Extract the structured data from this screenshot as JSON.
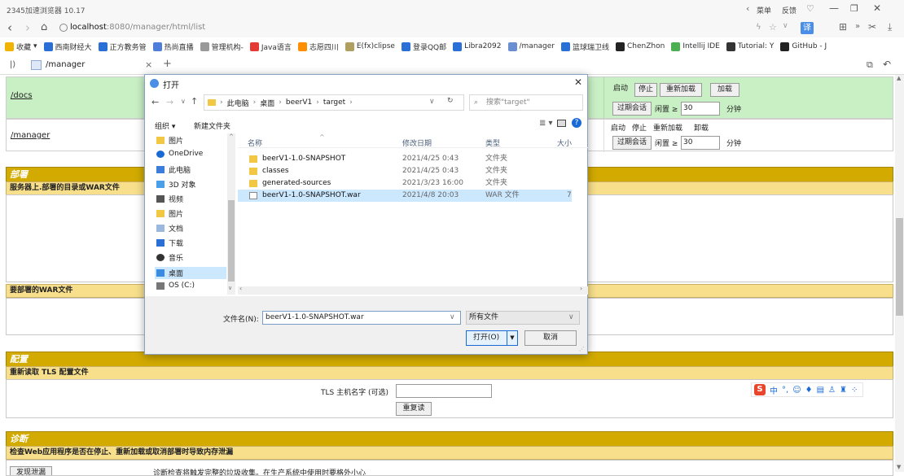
{
  "browser": {
    "app_title": "2345加速浏览器 10.17",
    "top_right": {
      "menu": "菜单",
      "feedback": "反馈"
    },
    "url_host": "localhost",
    "url_rest": ":8080/manager/html/list",
    "ext_label": "译"
  },
  "bookmarks": [
    {
      "label": "收藏",
      "color": "#f0b400"
    },
    {
      "label": "西南财经大",
      "color": "#2a6fd6"
    },
    {
      "label": "正方教务管",
      "color": "#2a6fd6"
    },
    {
      "label": "热尚直播",
      "color": "#4e7ed9"
    },
    {
      "label": "管理机构-",
      "color": "#999999"
    },
    {
      "label": "Java语言",
      "color": "#e53935"
    },
    {
      "label": "志愿四川",
      "color": "#ff8f00"
    },
    {
      "label": "E(fx)clipse",
      "color": "#b0a060"
    },
    {
      "label": "登录QQ邮",
      "color": "#2a6fd6"
    },
    {
      "label": "Libra2092",
      "color": "#2a6fd6"
    },
    {
      "label": "/manager",
      "color": "#6a8fd0"
    },
    {
      "label": "篮球瑞卫线",
      "color": "#2a6fd6"
    },
    {
      "label": "ChenZhon",
      "color": "#222222"
    },
    {
      "label": "Intellij IDE",
      "color": "#4caf50"
    },
    {
      "label": "Tutorial: Y",
      "color": "#333333"
    },
    {
      "label": "GitHub - J",
      "color": "#222222"
    }
  ],
  "tab": {
    "title": "/manager"
  },
  "manager": {
    "rows": [
      {
        "path": "/docs",
        "start": "启动",
        "stop": "停止",
        "reload": "重新加载",
        "deploy": "加载",
        "expire": "过期会话",
        "idle": "闲置 ≥",
        "idle_value": "30",
        "minutes": "分钟"
      },
      {
        "path": "/manager",
        "start": "启动",
        "stop": "停止",
        "reload": "重新加载",
        "deploy": "卸载",
        "expire": "过期会话",
        "idle": "闲置 ≥",
        "idle_value": "30",
        "minutes": "分钟"
      }
    ],
    "deploy": {
      "title": "部署",
      "server_dir": "服务器上.部署的目录或WAR文件",
      "war_upload": "要部署的WAR文件"
    },
    "config": {
      "title": "配置",
      "reload_tls": "重新读取 TLS 配置文件",
      "tls_label": "TLS 主机名字 (可选)",
      "reread": "重复读"
    },
    "diag": {
      "title": "诊断",
      "check": "检查Web应用程序是否在停止、重新加载或取消部署时导致内存泄漏",
      "find_btn": "发现泄漏",
      "find_desc": "诊断检查将触发完整的垃圾收集。在生产系统中使用时要格外小心"
    }
  },
  "ime": {
    "label": "中"
  },
  "dialog": {
    "title": "打开",
    "breadcrumb": [
      "此电脑",
      "桌面",
      "beerV1",
      "target"
    ],
    "search_placeholder": "搜索\"target\"",
    "organize": "组织 ▾",
    "new_folder": "新建文件夹",
    "columns": {
      "name": "名称",
      "date": "修改日期",
      "type": "类型",
      "size": "大小"
    },
    "nav": [
      {
        "label": "图片",
        "icon": "picture-icon"
      },
      {
        "label": "OneDrive",
        "icon": "cloud-icon"
      },
      {
        "label": "此电脑",
        "icon": "computer-icon"
      },
      {
        "label": "3D 对象",
        "icon": "cube-icon"
      },
      {
        "label": "视频",
        "icon": "video-icon"
      },
      {
        "label": "图片",
        "icon": "picture-icon"
      },
      {
        "label": "文档",
        "icon": "document-icon"
      },
      {
        "label": "下载",
        "icon": "download-icon"
      },
      {
        "label": "音乐",
        "icon": "music-icon"
      },
      {
        "label": "桌面",
        "icon": "desktop-icon"
      },
      {
        "label": "OS (C:)",
        "icon": "drive-icon"
      }
    ],
    "files": [
      {
        "name": "beerV1-1.0-SNAPSHOT",
        "date": "2021/4/25 0:43",
        "type": "文件夹",
        "size": "",
        "kind": "folder",
        "selected": false
      },
      {
        "name": "classes",
        "date": "2021/4/25 0:43",
        "type": "文件夹",
        "size": "",
        "kind": "folder",
        "selected": false
      },
      {
        "name": "generated-sources",
        "date": "2021/3/23 16:00",
        "type": "文件夹",
        "size": "",
        "kind": "folder",
        "selected": false
      },
      {
        "name": "beerV1-1.0-SNAPSHOT.war",
        "date": "2021/4/8 20:03",
        "type": "WAR 文件",
        "size": "7",
        "kind": "file",
        "selected": true
      }
    ],
    "filename_label": "文件名(N):",
    "filename_value": "beerV1-1.0-SNAPSHOT.war",
    "filter": "所有文件",
    "open_btn": "打开(O)",
    "cancel_btn": "取消"
  }
}
